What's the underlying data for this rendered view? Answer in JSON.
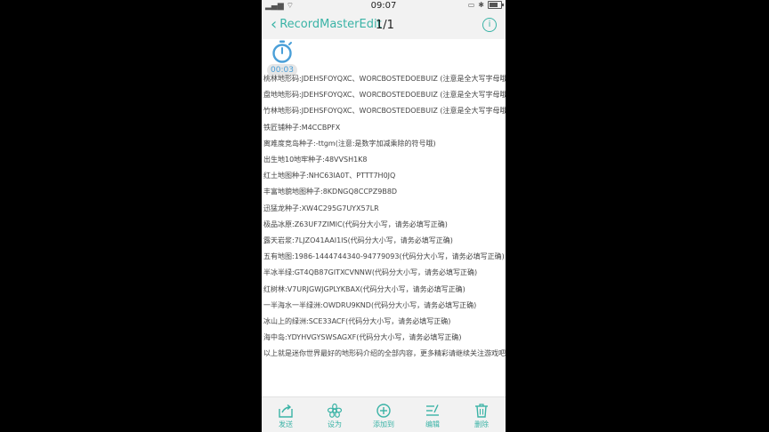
{
  "status_bar": {
    "time": "09:07"
  },
  "nav": {
    "back_label": "RecordMasterEdit",
    "counter": "1/1"
  },
  "recorder": {
    "elapsed": "00:03"
  },
  "lines": [
    "桃林地形码:JDEHSFOYQXC、WORCBOSTEDOEBUIZ (注意是全大写字母哦)",
    "盘地地形码:JDEHSFOYQXC、WORCBOSTEDOEBUIZ (注意是全大写字母哦)",
    "竹林地形码:JDEHSFOYQXC、WORCBOSTEDOEBUIZ (注意是全大写字母哦)",
    "铁匠铺种子:M4CCBPFX",
    "离难度竞岛种子:-ttgm(注意:是数字加减乘除的符号哦)",
    "出生地10地牢种子:48VVSH1K8",
    "红土地图种子:NHC63IA0T、PTTT7H0JQ",
    "丰富地貌地图种子:8KDNGQ8CCPZ9B8D",
    "迅猛龙种子:XW4C295G7UYX57LR",
    "极品冰原:Z63UF7ZIMIC(代码分大小写，请务必填写正确)",
    "露天岩浆:7LJZO41AAI1IS(代码分大小写，请务必填写正确)",
    "五有地图:1986-1444744340-94779093(代码分大小写，请务必填写正确)",
    "半冰半绿:GT4QB87GITXCVNNW(代码分大小写，请务必填写正确)",
    "红树林:V7URJGWJGPLYKBAX(代码分大小写，请务必填写正确)",
    "一半海水一半绿洲:OWDRU9KND(代码分大小写，请务必填写正确)",
    "冰山上的绿洲:SCE33ACF(代码分大小写，请务必填写正确)",
    "海中岛:YDYHVGYSWSAGXF(代码分大小写，请务必填写正确)",
    "以上就是迷你世界最好的地形码介绍的全部内容，更多精彩请继续关注游戏吧。"
  ],
  "toolbar": {
    "send": "发送",
    "set_as": "设为",
    "add_to": "添加到",
    "edit": "编辑",
    "delete": "删除"
  },
  "colors": {
    "accent": "#3ab3a6",
    "timer_blue": "#4a9fd8"
  }
}
